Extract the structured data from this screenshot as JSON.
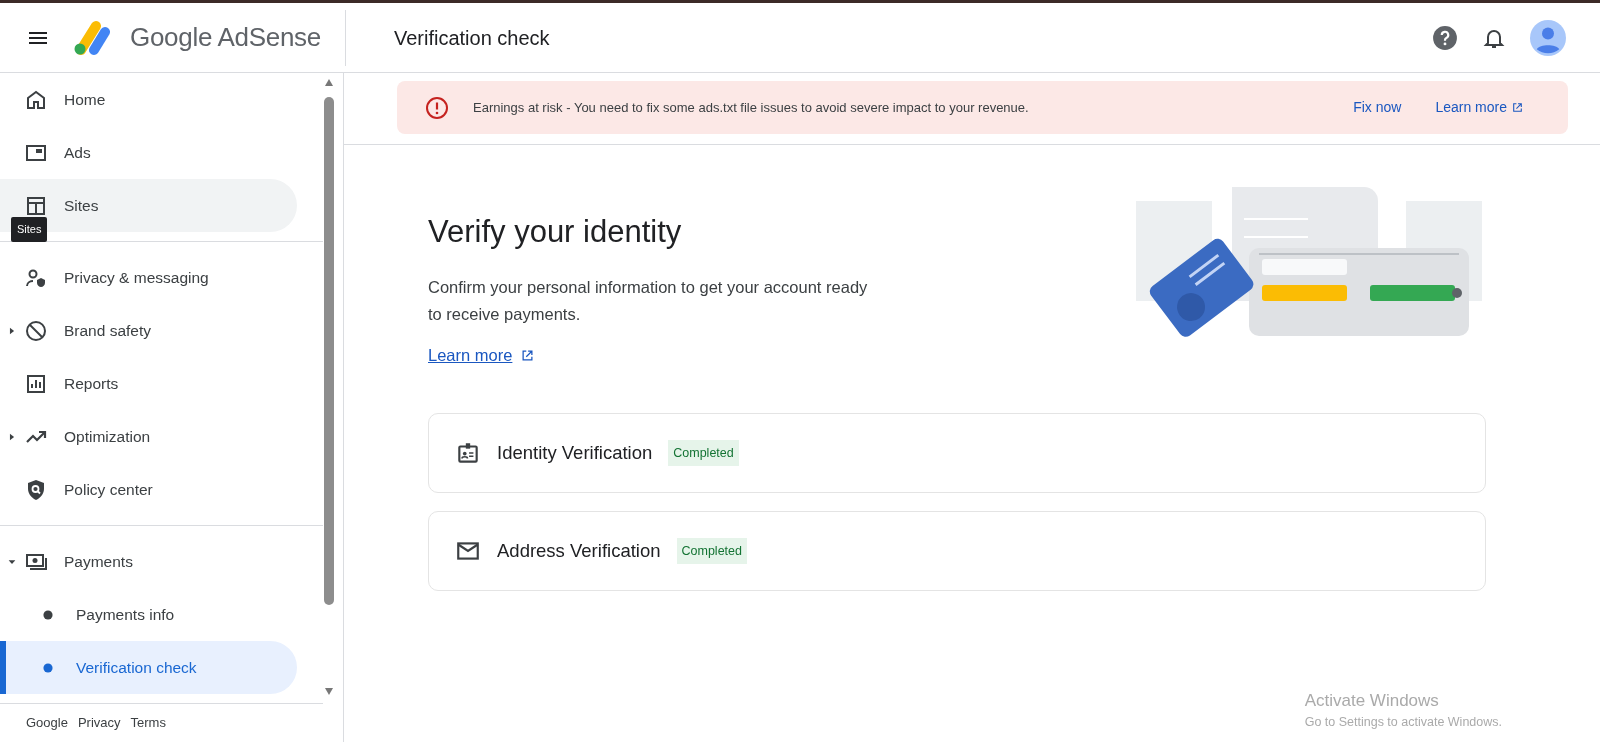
{
  "header": {
    "product": "Google AdSense",
    "page_title": "Verification check"
  },
  "sidebar": {
    "sections": [
      [
        {
          "label": "Home",
          "kind": "link",
          "selected": false,
          "hovered": false
        },
        {
          "label": "Ads",
          "kind": "link",
          "selected": false,
          "hovered": false
        },
        {
          "label": "Sites",
          "kind": "link",
          "selected": false,
          "hovered": true
        }
      ],
      [
        {
          "label": "Privacy & messaging",
          "kind": "link",
          "selected": false,
          "hovered": false
        },
        {
          "label": "Brand safety",
          "kind": "group",
          "expanded": false,
          "selected": false,
          "hovered": false
        },
        {
          "label": "Reports",
          "kind": "link",
          "selected": false,
          "hovered": false
        },
        {
          "label": "Optimization",
          "kind": "group",
          "expanded": false,
          "selected": false,
          "hovered": false
        },
        {
          "label": "Policy center",
          "kind": "link",
          "selected": false,
          "hovered": false
        }
      ],
      [
        {
          "label": "Payments",
          "kind": "group",
          "expanded": true,
          "selected": false,
          "hovered": false
        },
        {
          "label": "Payments info",
          "kind": "sub",
          "selected": false,
          "hovered": false
        },
        {
          "label": "Verification check",
          "kind": "sub",
          "selected": true,
          "hovered": false
        }
      ]
    ],
    "tooltip": "Sites",
    "footer_links": [
      "Google",
      "Privacy",
      "Terms"
    ]
  },
  "alert": {
    "message": "Earnings at risk - You need to fix some ads.txt file issues to avoid severe impact to your revenue.",
    "actions": [
      "Fix now",
      "Learn more"
    ]
  },
  "main": {
    "title": "Verify your identity",
    "description": "Confirm your personal information to get your account ready to receive payments.",
    "link": "Learn more",
    "steps": [
      {
        "title": "Identity Verification",
        "status": "Completed"
      },
      {
        "title": "Address Verification",
        "status": "Completed"
      }
    ]
  },
  "os_notice": {
    "title": "Activate Windows",
    "subtitle": "Go to Settings to activate Windows."
  }
}
